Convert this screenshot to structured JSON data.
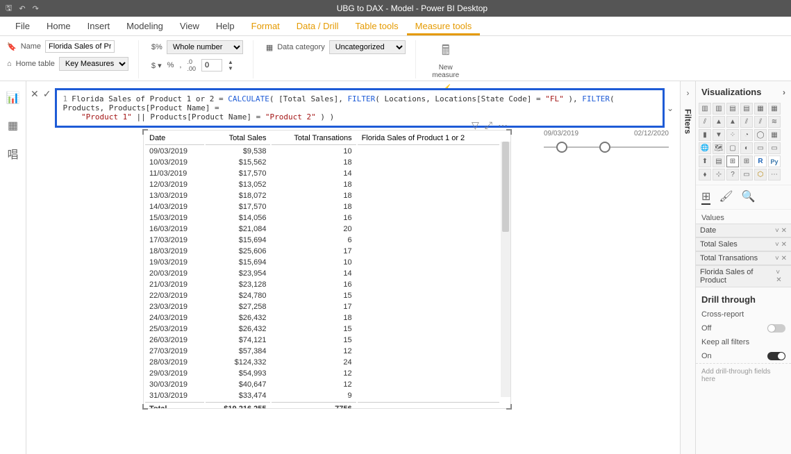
{
  "titlebar": {
    "title": "UBG to DAX - Model - Power BI Desktop"
  },
  "menu": {
    "file": "File",
    "home": "Home",
    "insert": "Insert",
    "modeling": "Modeling",
    "view": "View",
    "help": "Help",
    "format": "Format",
    "datadrill": "Data / Drill",
    "tabletools": "Table tools",
    "measuretools": "Measure tools"
  },
  "ribbon": {
    "name_label": "Name",
    "name_value": "Florida Sales of Pro...",
    "hometable_label": "Home table",
    "hometable_value": "Key Measures",
    "format_label": "Whole number",
    "decimals": "0",
    "datacategory_label": "Data category",
    "datacategory_value": "Uncategorized",
    "newmeasure": "New measure",
    "quickmeasure": "Quick measure"
  },
  "formula": {
    "line_number": "1",
    "measure_name": "Florida Sales of Product 1 or 2",
    "kw_calc": "CALCULATE",
    "kw_filter": "FILTER",
    "arg_total": "[Total Sales]",
    "arg_loc": "Locations",
    "arg_loc_col": "Locations[State Code]",
    "str_fl": "\"FL\"",
    "arg_prod": "Products",
    "arg_prod_col": "Products[Product Name]",
    "str_p1": "\"Product 1\"",
    "str_p2": "\"Product 2\""
  },
  "slider": {
    "start": "09/03/2019",
    "end": "02/12/2020"
  },
  "table": {
    "headers": {
      "date": "Date",
      "sales": "Total Sales",
      "trans": "Total Transations",
      "florida": "Florida Sales of Product 1 or 2"
    },
    "rows": [
      {
        "date": "09/03/2019",
        "sales": "$9,538",
        "trans": "10",
        "fl": ""
      },
      {
        "date": "10/03/2019",
        "sales": "$15,562",
        "trans": "18",
        "fl": ""
      },
      {
        "date": "11/03/2019",
        "sales": "$17,570",
        "trans": "14",
        "fl": ""
      },
      {
        "date": "12/03/2019",
        "sales": "$13,052",
        "trans": "18",
        "fl": ""
      },
      {
        "date": "13/03/2019",
        "sales": "$18,072",
        "trans": "18",
        "fl": ""
      },
      {
        "date": "14/03/2019",
        "sales": "$17,570",
        "trans": "18",
        "fl": ""
      },
      {
        "date": "15/03/2019",
        "sales": "$14,056",
        "trans": "16",
        "fl": ""
      },
      {
        "date": "16/03/2019",
        "sales": "$21,084",
        "trans": "20",
        "fl": ""
      },
      {
        "date": "17/03/2019",
        "sales": "$15,694",
        "trans": "6",
        "fl": ""
      },
      {
        "date": "18/03/2019",
        "sales": "$25,606",
        "trans": "17",
        "fl": ""
      },
      {
        "date": "19/03/2019",
        "sales": "$15,694",
        "trans": "10",
        "fl": ""
      },
      {
        "date": "20/03/2019",
        "sales": "$23,954",
        "trans": "14",
        "fl": ""
      },
      {
        "date": "21/03/2019",
        "sales": "$23,128",
        "trans": "16",
        "fl": ""
      },
      {
        "date": "22/03/2019",
        "sales": "$24,780",
        "trans": "15",
        "fl": ""
      },
      {
        "date": "23/03/2019",
        "sales": "$27,258",
        "trans": "17",
        "fl": ""
      },
      {
        "date": "24/03/2019",
        "sales": "$26,432",
        "trans": "18",
        "fl": ""
      },
      {
        "date": "25/03/2019",
        "sales": "$26,432",
        "trans": "15",
        "fl": ""
      },
      {
        "date": "26/03/2019",
        "sales": "$74,121",
        "trans": "15",
        "fl": ""
      },
      {
        "date": "27/03/2019",
        "sales": "$57,384",
        "trans": "12",
        "fl": ""
      },
      {
        "date": "28/03/2019",
        "sales": "$124,332",
        "trans": "24",
        "fl": ""
      },
      {
        "date": "29/03/2019",
        "sales": "$54,993",
        "trans": "12",
        "fl": ""
      },
      {
        "date": "30/03/2019",
        "sales": "$40,647",
        "trans": "12",
        "fl": ""
      },
      {
        "date": "31/03/2019",
        "sales": "$33,474",
        "trans": "9",
        "fl": ""
      }
    ],
    "total": {
      "label": "Total",
      "sales": "$19,216,255",
      "trans": "7756",
      "fl": ""
    }
  },
  "filters": {
    "label": "Filters"
  },
  "viz": {
    "title": "Visualizations",
    "values_label": "Values",
    "wells": [
      {
        "label": "Date"
      },
      {
        "label": "Total Sales"
      },
      {
        "label": "Total Transations"
      },
      {
        "label": "Florida Sales of Product"
      }
    ],
    "drill": {
      "title": "Drill through",
      "cross": "Cross-report",
      "off": "Off",
      "keep": "Keep all filters",
      "on": "On",
      "hint": "Add drill-through fields here"
    }
  }
}
